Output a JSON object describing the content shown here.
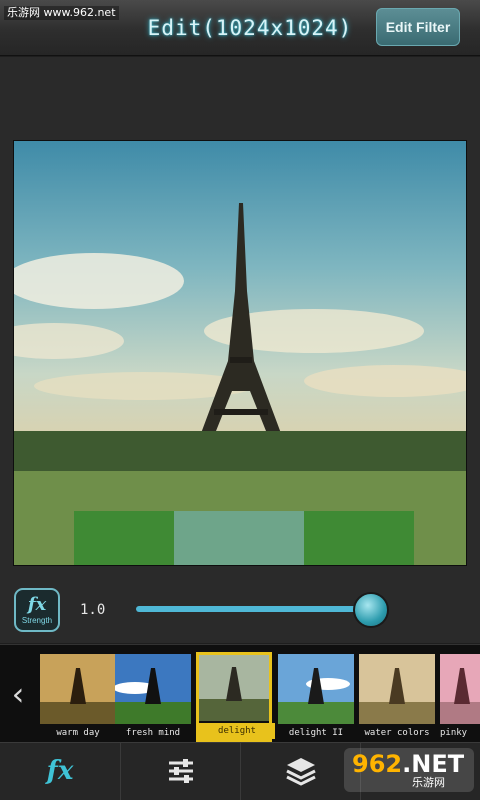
{
  "watermark_top": "乐游网 www.962.net",
  "header": {
    "title": "Edit(1024x1024)",
    "edit_filter_label": "Edit Filter"
  },
  "strength": {
    "fx_label": "fx",
    "strength_label": "Strength",
    "value_text": "1.0",
    "value": 1.0
  },
  "filters": [
    {
      "name": "warm day",
      "selected": false
    },
    {
      "name": "fresh mind",
      "selected": false
    },
    {
      "name": "delight",
      "selected": true
    },
    {
      "name": "delight II",
      "selected": false
    },
    {
      "name": "water colors",
      "selected": false
    },
    {
      "name": "pinky",
      "selected": false
    }
  ],
  "tabs": {
    "fx_label": "fx"
  },
  "watermark_br": {
    "big_prefix": "962",
    "big_suffix": ".NET",
    "small": "乐游网"
  },
  "colors": {
    "accent": "#3fc3d6",
    "selected_filter": "#e8c21c"
  },
  "icons": [
    "back-arrow-icon",
    "adjustments-icon",
    "layers-icon"
  ]
}
